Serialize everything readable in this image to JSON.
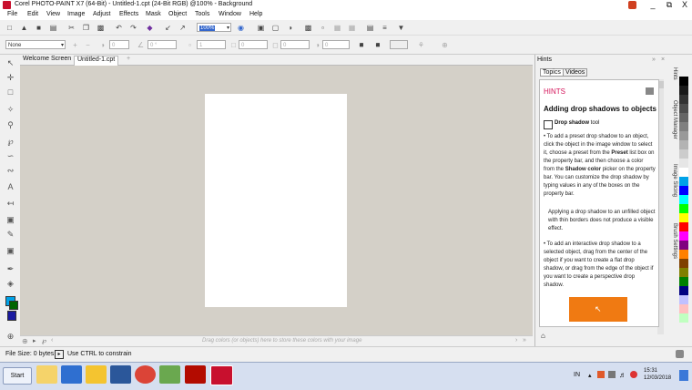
{
  "window": {
    "title": "Corel PHOTO-PAINT X7 (64-Bit) - Untitled-1.cpt (24-Bit RGB) @100% - Background",
    "controls": [
      "_",
      "⧉",
      "X"
    ]
  },
  "menu": [
    "File",
    "Edit",
    "View",
    "Image",
    "Adjust",
    "Effects",
    "Mask",
    "Object",
    "Tools",
    "Window",
    "Help"
  ],
  "toolbar": {
    "zoom_value": "100%"
  },
  "property_bar": {
    "preset_value": "None",
    "field_1": "0",
    "field_2": "0 °",
    "field_3": "1",
    "field_4": "0",
    "field_5": "0",
    "field_6": "0"
  },
  "doc_tabs": {
    "welcome": "Welcome Screen",
    "current": "Untitled-1.cpt",
    "add": "+"
  },
  "color_dock": {
    "hint": "Drag colors (or objects) here to store these colors with your image"
  },
  "hints": {
    "panel_title": "Hints",
    "tabs": [
      "Topics",
      "Videos"
    ],
    "header": "HINTS",
    "heading": "Adding drop shadows to objects",
    "tool_label": "Drop shadow",
    "tool_suffix": " tool",
    "para1_a": "• To add a preset drop shadow to an object, click the object in the image window to select it, choose a preset from the ",
    "para1_b": "Preset",
    "para1_c": " list box on the property bar, and then choose a color from the ",
    "para1_d": "Shadow color",
    "para1_e": " picker on the property bar. You can customize the drop shadow by typing values in any of the boxes on the property bar.",
    "para2": "Applying a drop shadow to an unfilled object with thin borders does not produce a visible effect.",
    "para3": "• To add an interactive drop shadow to a selected object, drag from the center of the object if you want to create a flat drop shadow, or drag from the edge of the object if you want to create a perspective drop shadow."
  },
  "side_tabs": [
    "Hints",
    "Object Manager",
    "Image Slicing",
    "Brush Settings"
  ],
  "palette_colors": [
    "#000000",
    "#1a1a1a",
    "#333333",
    "#4d4d4d",
    "#666666",
    "#808080",
    "#999999",
    "#b3b3b3",
    "#cccccc",
    "#e6e6e6",
    "#ffffff",
    "#00a2e8",
    "#0000ff",
    "#00ffff",
    "#00ff00",
    "#ffff00",
    "#ff0000",
    "#ff00ff",
    "#800080",
    "#ff8000",
    "#804000",
    "#808000",
    "#008000",
    "#000080",
    "#c0c0ff",
    "#ffc0c0",
    "#c0ffc0"
  ],
  "status": {
    "file_size": "File Size: 0 bytes",
    "hint": "Use CTRL to constrain"
  },
  "taskbar": {
    "start": "Start",
    "lang": "IN",
    "time": "15:31",
    "date": "12/03/2018"
  }
}
